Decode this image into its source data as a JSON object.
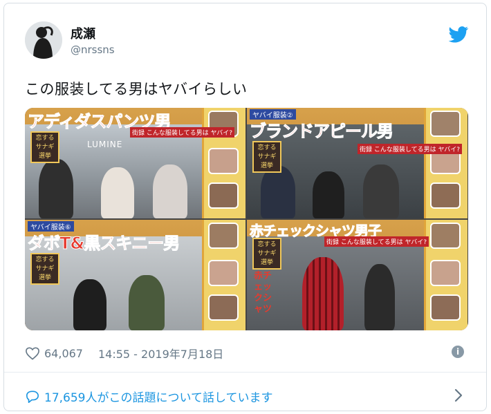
{
  "tweet": {
    "display_name": "成瀬",
    "handle": "@nrssns",
    "text": "この服装してる男はヤバイらしい",
    "like_count": "64,067",
    "timestamp": "14:55 - 2019年7月18日",
    "conversation_text": "17,659人がこの話題について話しています"
  },
  "media": {
    "panels": [
      {
        "tag": "",
        "title": "アディダスパンツ男",
        "subtitle": "街録 こんな服装してる男は ヤバイ?",
        "sign": "LUMINE"
      },
      {
        "tag": "ヤバイ服装②",
        "title": "ブランドアピール男",
        "subtitle": "街録 こんな服装してる男は ヤバイ?",
        "sign": ""
      },
      {
        "tag": "ヤバイ服装⑥",
        "title": "ダボT&黒スキニー男",
        "subtitle": "",
        "sign": ""
      },
      {
        "tag": "",
        "title": "赤チェックシャツ男子",
        "subtitle": "街録 こんな服装してる男は ヤバイ?",
        "sign": "赤チェックシャツ"
      }
    ],
    "badge_text": "恋する サナギ 選挙"
  },
  "icons": {
    "brand": "twitter-bird-icon",
    "like": "heart-icon",
    "info": "info-icon",
    "conversation": "speech-bubble-icon",
    "chevron": "chevron-right-icon"
  },
  "colors": {
    "accent": "#1da1f2",
    "link": "#1b95e0",
    "muted": "#657786",
    "border": "#d6dde3"
  }
}
